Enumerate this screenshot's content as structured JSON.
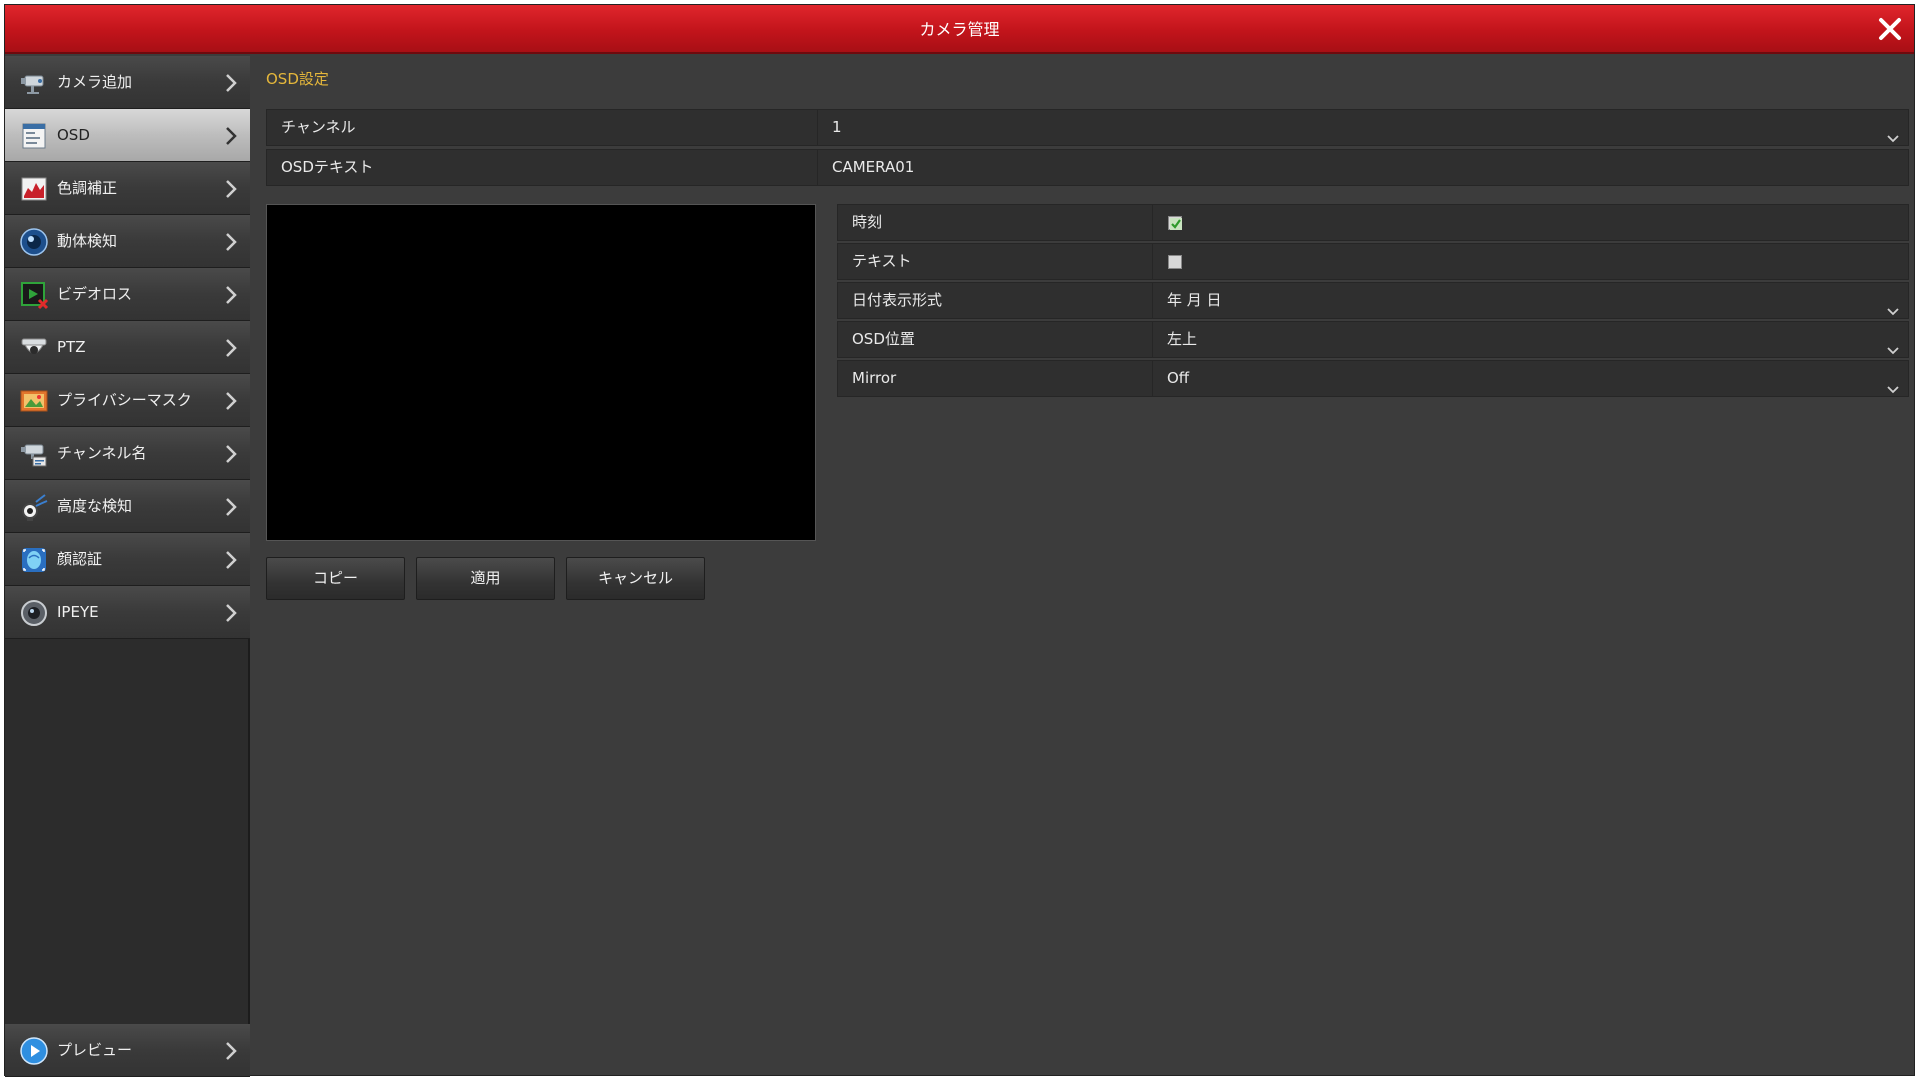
{
  "window": {
    "title": "カメラ管理"
  },
  "sidebar": {
    "items": [
      {
        "label": "カメラ追加",
        "icon": "camera-add-icon"
      },
      {
        "label": "OSD",
        "icon": "osd-icon",
        "active": true
      },
      {
        "label": "色調補正",
        "icon": "color-adjust-icon"
      },
      {
        "label": "動体検知",
        "icon": "motion-detect-icon"
      },
      {
        "label": "ビデオロス",
        "icon": "video-loss-icon"
      },
      {
        "label": "PTZ",
        "icon": "ptz-icon"
      },
      {
        "label": "プライバシーマスク",
        "icon": "privacy-mask-icon"
      },
      {
        "label": "チャンネル名",
        "icon": "channel-name-icon"
      },
      {
        "label": "高度な検知",
        "icon": "advanced-detect-icon"
      },
      {
        "label": "顔認証",
        "icon": "face-recognition-icon"
      },
      {
        "label": "IPEYE",
        "icon": "ipeye-icon"
      }
    ],
    "preview": {
      "label": "プレビュー",
      "icon": "play-icon"
    }
  },
  "main": {
    "section_title": "OSD設定",
    "channel": {
      "label": "チャンネル",
      "value": "1"
    },
    "osd_text": {
      "label": "OSDテキスト",
      "value": "CAMERA01"
    },
    "settings": {
      "time": {
        "label": "時刻",
        "checked": true
      },
      "text": {
        "label": "テキスト",
        "checked": false
      },
      "date_format": {
        "label": "日付表示形式",
        "value": "年 月 日"
      },
      "osd_position": {
        "label": "OSD位置",
        "value": "左上"
      },
      "mirror": {
        "label": "Mirror",
        "value": "Off"
      }
    },
    "buttons": {
      "copy": "コピー",
      "apply": "適用",
      "cancel": "キャンセル"
    }
  },
  "colors": {
    "titlebar": "#c2141b",
    "accent_title": "#e5b73b",
    "background": "#3c3c3c",
    "check_green": "#3fa535"
  }
}
